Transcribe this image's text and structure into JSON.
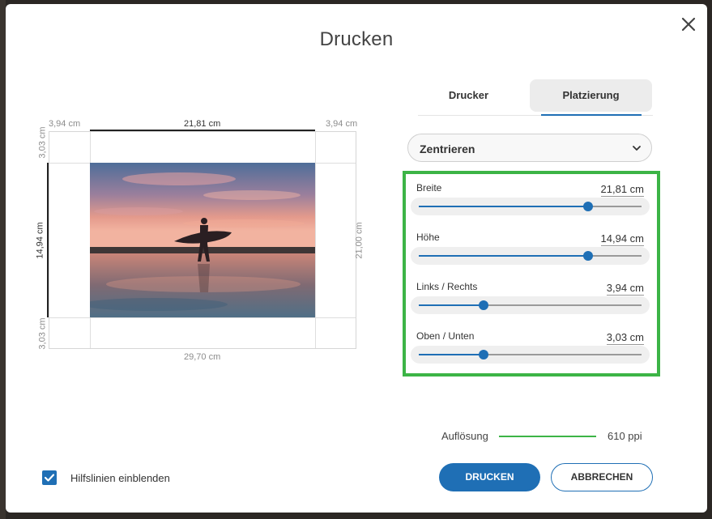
{
  "dialog": {
    "title": "Drucken"
  },
  "tabs": [
    {
      "label": "Drucker",
      "active": false
    },
    {
      "label": "Platzierung",
      "active": true
    }
  ],
  "placement_select": {
    "value": "Zentrieren"
  },
  "sliders": [
    {
      "label": "Breite",
      "value": "21,81 cm",
      "level": 0.76
    },
    {
      "label": "Höhe",
      "value": "14,94 cm",
      "level": 0.76
    },
    {
      "label": "Links / Rechts",
      "value": "3,94 cm",
      "level": 0.29
    },
    {
      "label": "Oben / Unten",
      "value": "3,03 cm",
      "level": 0.29
    }
  ],
  "resolution": {
    "label": "Auflösung",
    "value": "610 ppi"
  },
  "guides_checkbox": {
    "label": "Hilfslinien einblenden",
    "checked": true
  },
  "buttons": {
    "print": "DRUCKEN",
    "cancel": "ABBRECHEN"
  },
  "preview": {
    "margin_left": "3,94 cm",
    "image_width": "21,81 cm",
    "margin_right": "3,94 cm",
    "margin_top": "3,03 cm",
    "image_height": "14,94 cm",
    "margin_bottom": "3,03 cm",
    "paper_width": "29,70 cm",
    "paper_height": "21,00 cm"
  },
  "colors": {
    "accent": "#1f6fb5",
    "highlight": "#3cb446"
  },
  "icons": {
    "close": "close-icon",
    "chevron": "chevron-down-icon",
    "check": "check-icon"
  }
}
